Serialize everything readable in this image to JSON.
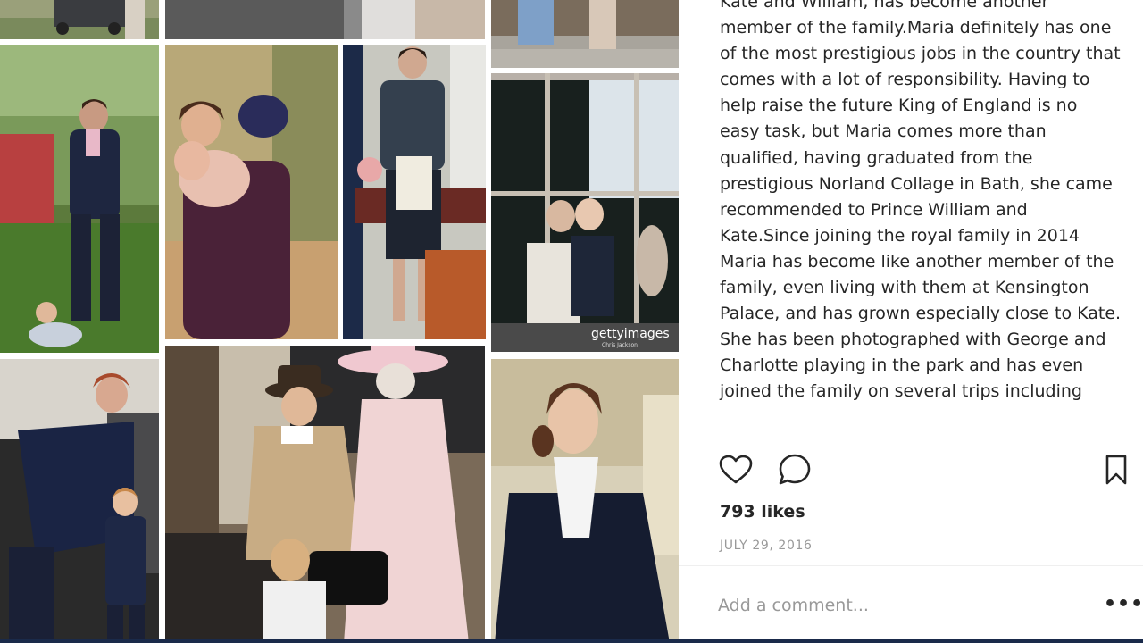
{
  "post": {
    "caption": "Kate and William, has become another member of the family.Maria definitely has one of the most prestigious jobs in the country that comes with a lot of responsibility. Having to help raise the future King of England is no easy task, but Maria comes more than qualified, having graduated from the prestigious Norland Collage in Bath, she came recommended to Prince William and Kate.Since joining the royal family in 2014 Maria has become like another member of the family, even living with them at Kensington Palace, and has grown especially close to Kate. She has been photographed with George and Charlotte playing in the park and has even joined the family on several trips including",
    "likes": "793 likes",
    "date": "JULY 29, 2016",
    "comment_placeholder": "Add a comment...",
    "more_label": "•••"
  },
  "photos": {
    "watermark_getty": "gettyimages",
    "watermark_credit": "Chris Jackson"
  },
  "icons": {
    "like": "heart-icon",
    "comment": "comment-icon",
    "save": "bookmark-icon"
  },
  "colors": {
    "text": "#262626",
    "muted": "#999999",
    "divider": "#efefef"
  }
}
